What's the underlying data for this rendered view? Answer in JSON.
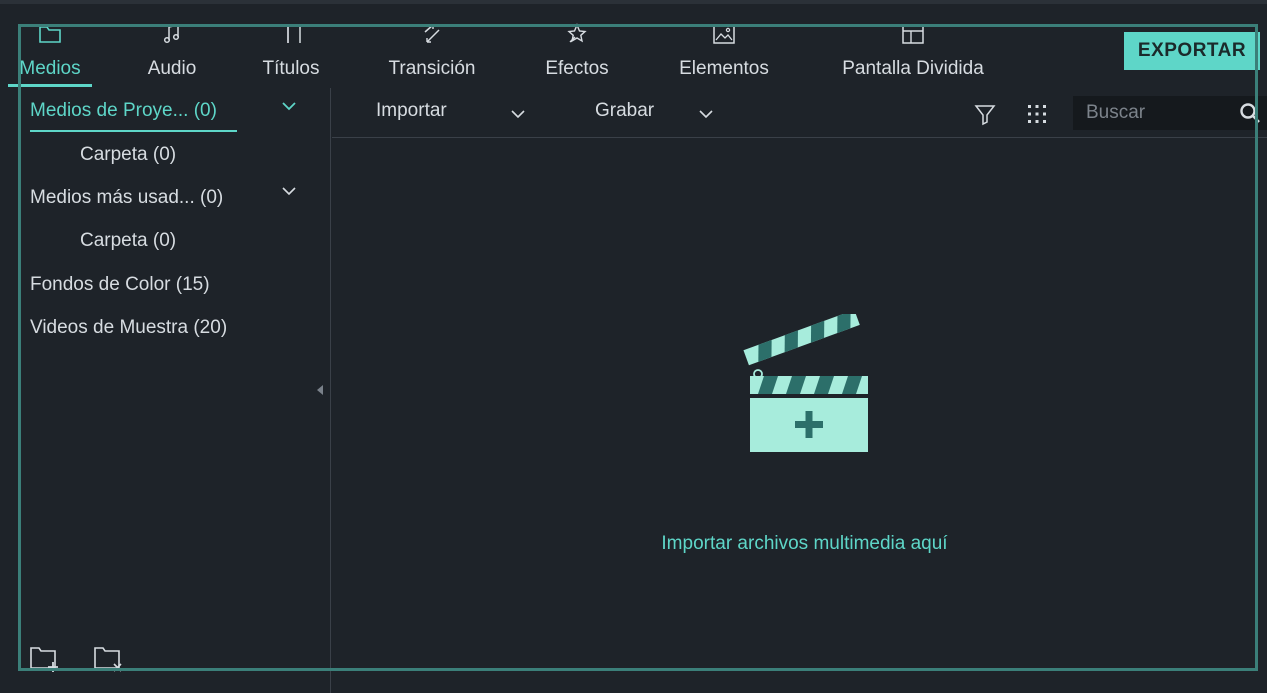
{
  "tabs": [
    {
      "label": "Medios",
      "icon": "folder-icon",
      "active": true
    },
    {
      "label": "Audio",
      "icon": "music-note-icon",
      "active": false
    },
    {
      "label": "Títulos",
      "icon": "text-title-icon",
      "active": false
    },
    {
      "label": "Transición",
      "icon": "transition-icon",
      "active": false
    },
    {
      "label": "Efectos",
      "icon": "effects-icon",
      "active": false
    },
    {
      "label": "Elementos",
      "icon": "image-icon",
      "active": false
    },
    {
      "label": "Pantalla Dividida",
      "icon": "split-screen-icon",
      "active": false
    }
  ],
  "export_label": "EXPORTAR",
  "sidebar": {
    "items": [
      {
        "label": "Medios de Proye... (0)",
        "active": true,
        "expandable": true
      },
      {
        "label": "Carpeta (0)",
        "active": false,
        "indent": true
      },
      {
        "label": "Medios más usad... (0)",
        "active": false,
        "expandable": true
      },
      {
        "label": "Carpeta (0)",
        "active": false,
        "indent": true
      },
      {
        "label": "Fondos de Color (15)",
        "active": false
      },
      {
        "label": "Videos de Muestra (20)",
        "active": false
      }
    ]
  },
  "toolbar": {
    "import_label": "Importar",
    "record_label": "Grabar",
    "search_placeholder": "Buscar"
  },
  "drop_zone": {
    "text": "Importar archivos multimedia aquí"
  },
  "colors": {
    "accent": "#5ed6c8",
    "background": "#1e2329",
    "frame": "#3b7f79"
  }
}
